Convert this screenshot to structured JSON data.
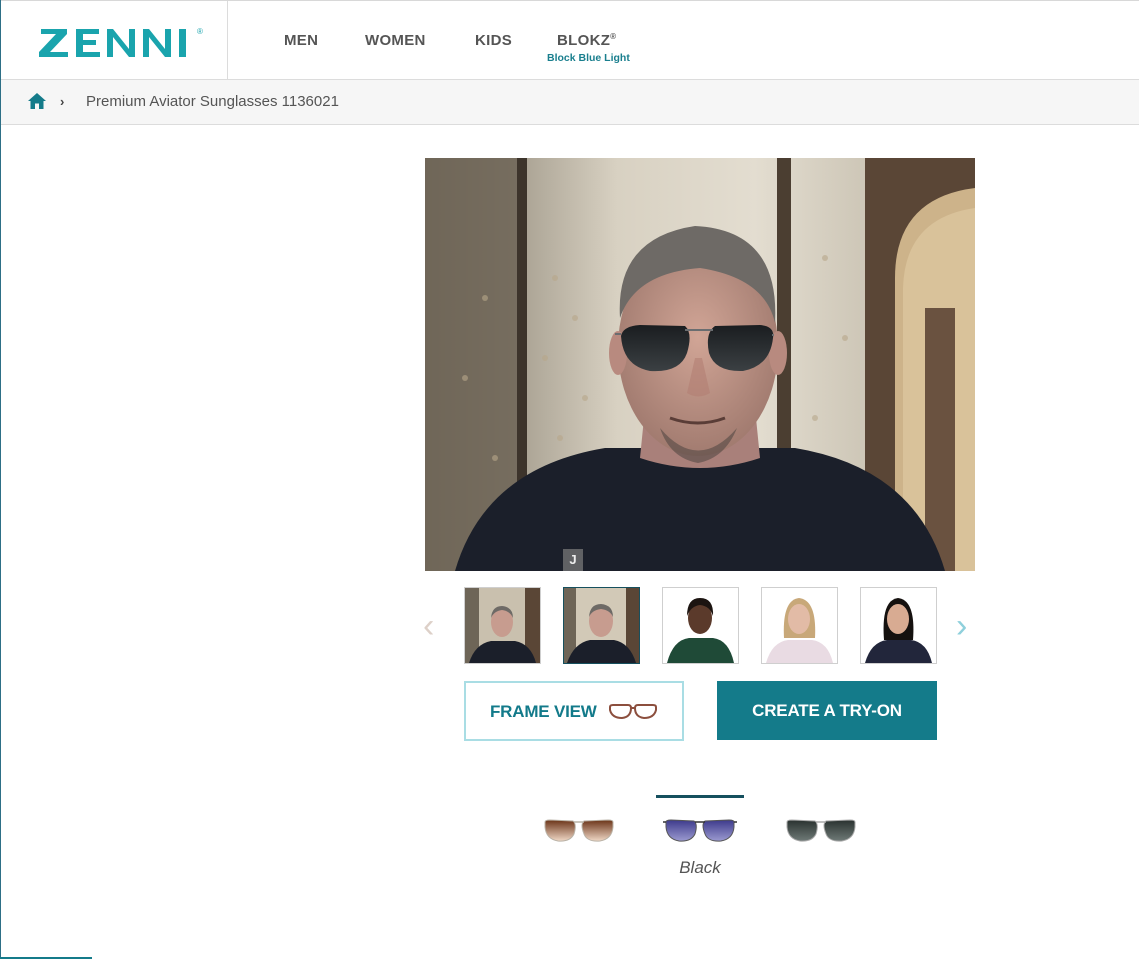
{
  "brand": {
    "logo_text": "ZENNI",
    "accent_color": "#147b8a",
    "logo_color": "#1aa4ad"
  },
  "nav": {
    "items": [
      {
        "label": "MEN"
      },
      {
        "label": "WOMEN"
      },
      {
        "label": "KIDS"
      },
      {
        "label": "BLOKZ",
        "sub": "Block Blue Light"
      }
    ],
    "registered_mark": "®"
  },
  "breadcrumb": {
    "home_icon": "home-icon",
    "separator_icon": "chevron-right-icon",
    "current": "Premium Aviator Sunglasses 1136021"
  },
  "viewer": {
    "main_image": "man-wearing-aviator-sunglasses",
    "watermark": "J",
    "thumbnails": [
      {
        "name": "user-tryon-1",
        "selected": false
      },
      {
        "name": "user-tryon-2",
        "selected": true
      },
      {
        "name": "model-woman-green",
        "selected": false
      },
      {
        "name": "model-woman-blonde",
        "selected": false
      },
      {
        "name": "model-woman-dark-hair",
        "selected": false
      }
    ],
    "prev_icon": "chevron-left-icon",
    "next_icon": "chevron-right-icon"
  },
  "actions": {
    "frame_view_label": "FRAME VIEW",
    "frame_view_icon": "glasses-icon",
    "create_tryon_label": "CREATE A TRY-ON"
  },
  "colors": {
    "options": [
      {
        "name": "brown-gradient-swatch",
        "lens": "#8a4a2a"
      },
      {
        "name": "black-swatch",
        "lens": "#5d5aa6"
      },
      {
        "name": "gray-swatch",
        "lens": "#3a4442"
      }
    ],
    "selected_label": "Black"
  }
}
